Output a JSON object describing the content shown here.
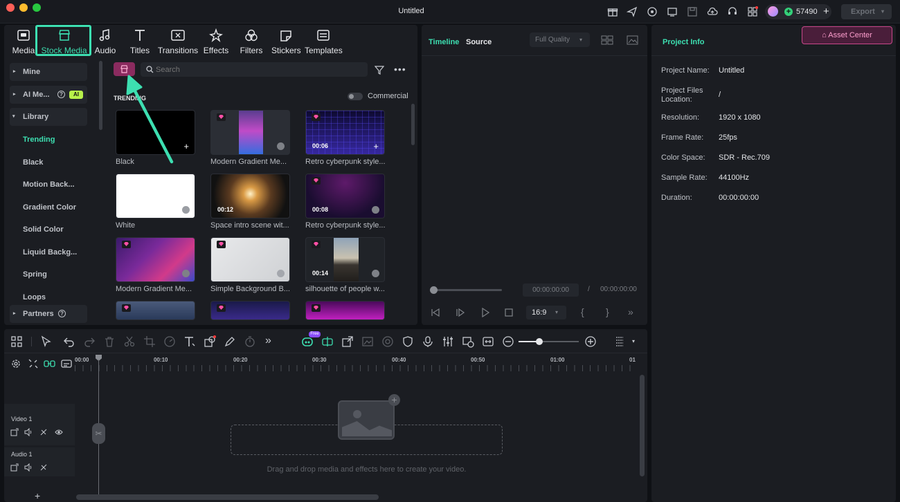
{
  "window": {
    "title": "Untitled",
    "credits": "57490",
    "export_label": "Export"
  },
  "tabs": [
    {
      "label": "Media",
      "icon": "media-icon"
    },
    {
      "label": "Stock Media",
      "icon": "stock-media-icon"
    },
    {
      "label": "Audio",
      "icon": "audio-icon"
    },
    {
      "label": "Titles",
      "icon": "titles-icon"
    },
    {
      "label": "Transitions",
      "icon": "transitions-icon"
    },
    {
      "label": "Effects",
      "icon": "effects-icon"
    },
    {
      "label": "Filters",
      "icon": "filters-icon"
    },
    {
      "label": "Stickers",
      "icon": "stickers-icon"
    },
    {
      "label": "Templates",
      "icon": "templates-icon"
    }
  ],
  "sidebar": {
    "mine": "Mine",
    "ai_media": "AI Me...",
    "ai_badge": "AI",
    "library": "Library",
    "items": [
      "Trending",
      "Black",
      "Motion Back...",
      "Gradient Color",
      "Solid Color",
      "Liquid Backg...",
      "Spring",
      "Loops"
    ],
    "partners": "Partners"
  },
  "search": {
    "placeholder": "Search"
  },
  "section_title": "TRENDING",
  "commercial_label": "Commercial",
  "media": [
    {
      "caption": "Black",
      "duration": ""
    },
    {
      "caption": "Modern Gradient Me...",
      "duration": ""
    },
    {
      "caption": "Retro cyberpunk style...",
      "duration": "00:06"
    },
    {
      "caption": "White",
      "duration": ""
    },
    {
      "caption": "Space intro scene wit...",
      "duration": "00:12"
    },
    {
      "caption": "Retro cyberpunk style...",
      "duration": "00:08"
    },
    {
      "caption": "Modern Gradient Me...",
      "duration": ""
    },
    {
      "caption": "Simple Background B...",
      "duration": ""
    },
    {
      "caption": "silhouette of people w...",
      "duration": "00:14"
    }
  ],
  "preview": {
    "tab_timeline": "Timeline",
    "tab_source": "Source",
    "quality": "Full Quality",
    "current_time": "00:00:00:00",
    "separator": "/",
    "total_time": "00:00:00:00",
    "aspect": "16:9"
  },
  "asset_center": "Asset Center",
  "project_info": {
    "title": "Project Info",
    "rows": [
      {
        "key": "Project Name:",
        "value": "Untitled"
      },
      {
        "key": "Project Files Location:",
        "value": "/"
      },
      {
        "key": "Resolution:",
        "value": "1920 x 1080"
      },
      {
        "key": "Frame Rate:",
        "value": "25fps"
      },
      {
        "key": "Color Space:",
        "value": "SDR - Rec.709"
      },
      {
        "key": "Sample Rate:",
        "value": "44100Hz"
      },
      {
        "key": "Duration:",
        "value": "00:00:00:00"
      }
    ]
  },
  "timeline": {
    "ruler": [
      "00:00",
      "00:10",
      "00:20",
      "00:30",
      "00:40",
      "00:50",
      "01:00",
      "01"
    ],
    "tracks": [
      {
        "name": "Video 1"
      },
      {
        "name": "Audio 1"
      }
    ],
    "free_badge": "Free",
    "drop_hint": "Drag and drop media and effects here to create your video.",
    "zoom": 0.35
  },
  "colors": {
    "accent": "#3ddfb1",
    "gem": "#ff4fa6",
    "asset_center": "#ff5fa8"
  }
}
